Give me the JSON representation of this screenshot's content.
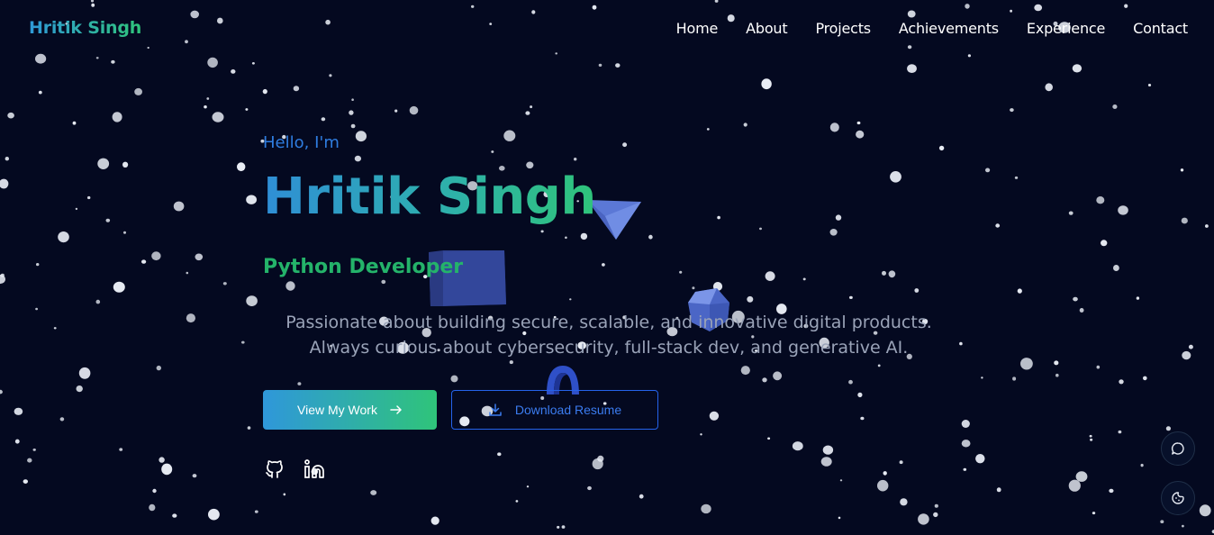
{
  "brand": {
    "name": "Hritik Singh"
  },
  "nav": {
    "items": [
      {
        "label": "Home"
      },
      {
        "label": "About"
      },
      {
        "label": "Projects"
      },
      {
        "label": "Achievements"
      },
      {
        "label": "Experience"
      },
      {
        "label": "Contact"
      }
    ]
  },
  "hero": {
    "greeting": "Hello, I'm",
    "name": "Hritik Singh",
    "role": "Python Developer",
    "tagline": [
      "Passionate about building secure, scalable, and innovative digital products.",
      "Always curious about cybersecurity, full-stack dev, and generative AI."
    ],
    "primary_button": "View My Work",
    "secondary_button": "Download Resume"
  },
  "social": {
    "icons": [
      "github-icon",
      "linkedin-icon"
    ]
  },
  "floating_actions": {
    "icons": [
      "chat-icon",
      "theme-icon"
    ]
  },
  "colors": {
    "background": "#040920",
    "gradient_start": "#2f8ed6",
    "gradient_end": "#2fc47a",
    "accent_blue": "#2f7de0",
    "role_green": "#24b36a",
    "tagline_gray": "#9aa3b8"
  }
}
